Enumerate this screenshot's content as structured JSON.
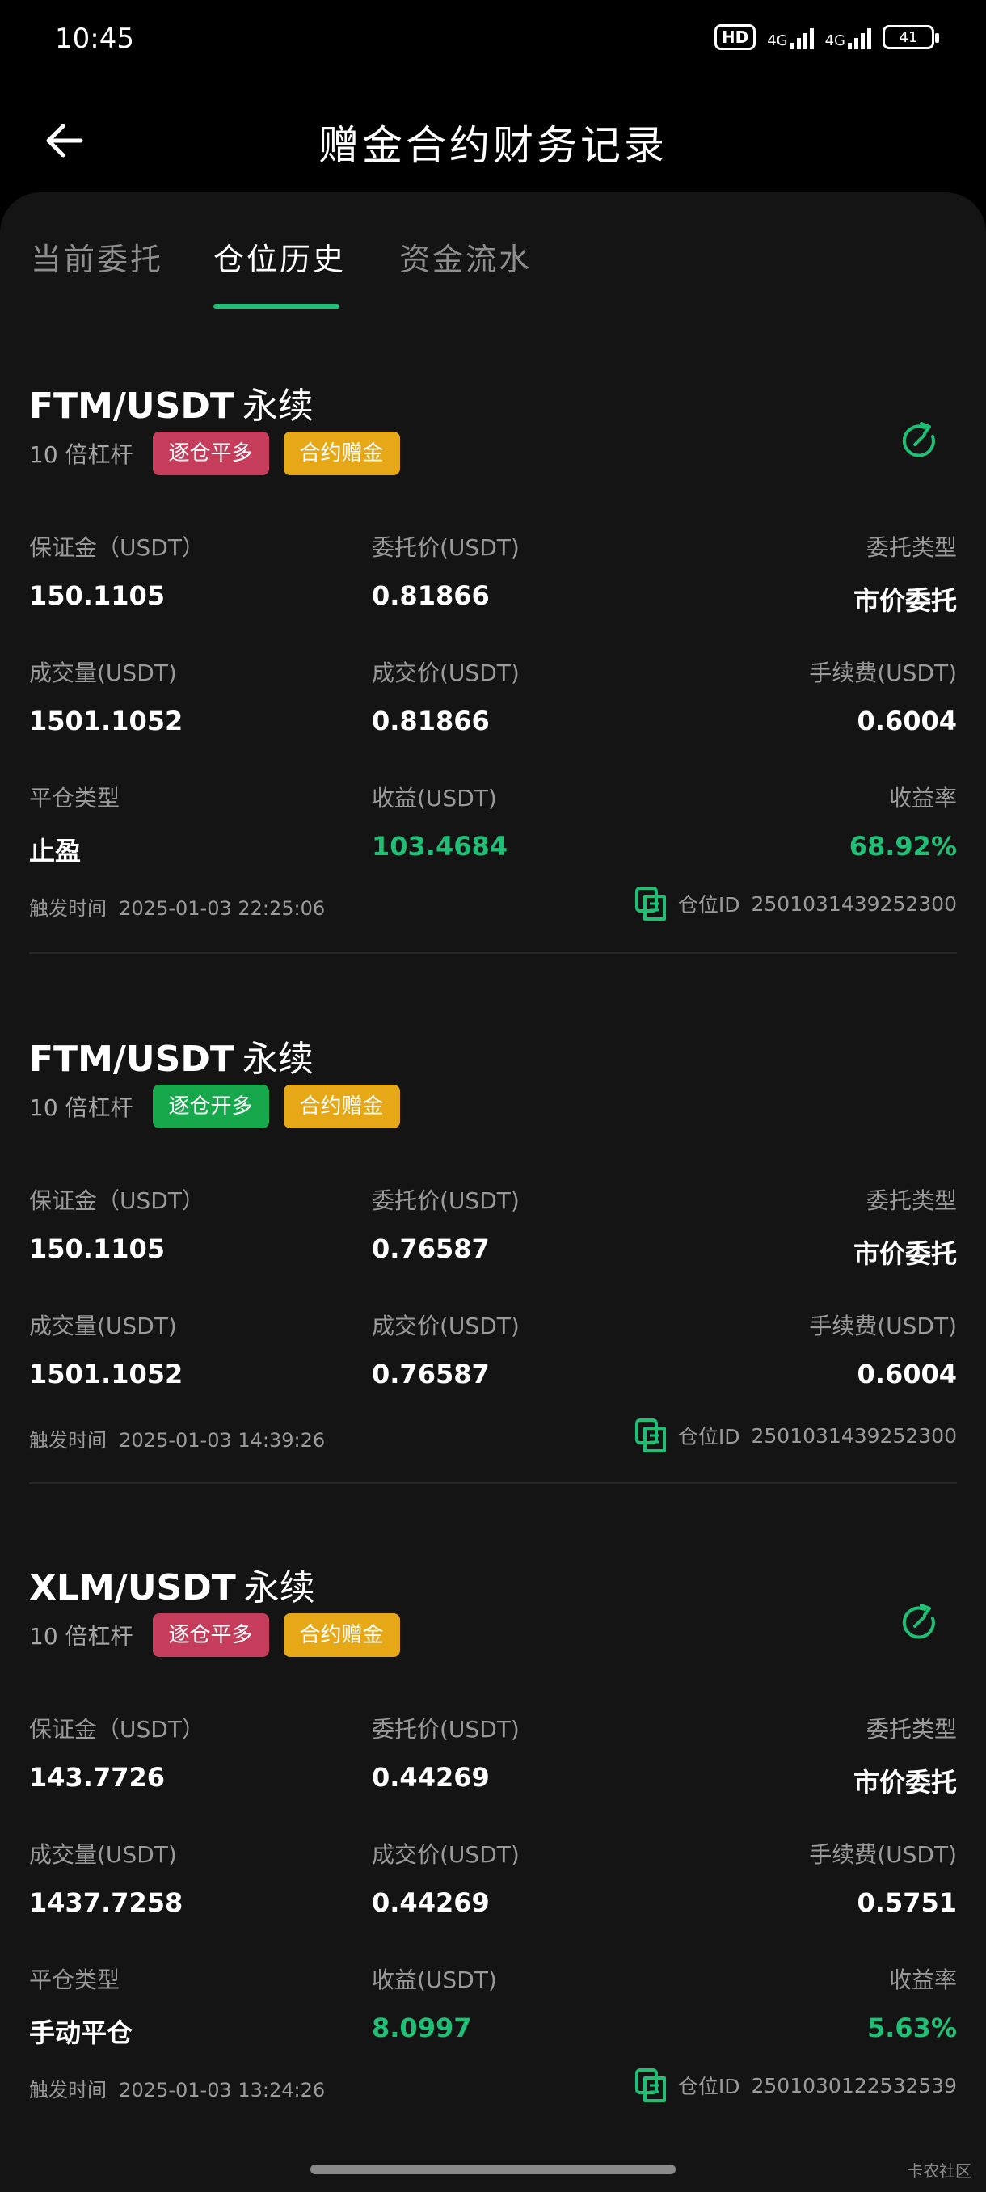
{
  "status_bar": {
    "time": "10:45",
    "hd": "HD",
    "net1": "4G",
    "net2": "4G",
    "battery": "41"
  },
  "header": {
    "title": "赠金合约财务记录"
  },
  "tabs": [
    {
      "label": "当前委托",
      "active": false
    },
    {
      "label": "仓位历史",
      "active": true
    },
    {
      "label": "资金流水",
      "active": false
    }
  ],
  "colors": {
    "accent": "#1fbf75",
    "tag_close_long": "#c63d5b",
    "tag_open_long": "#18a84c",
    "tag_bonus": "#e6a817"
  },
  "records": [
    {
      "pair": "FTM/USDT",
      "suffix": "永续",
      "leverage": "10 倍杠杆",
      "direction_tag": "逐仓平多",
      "bonus_tag": "合约赠金",
      "show_refresh": true,
      "fields": [
        {
          "label": "保证金（USDT）",
          "value": "150.1105"
        },
        {
          "label": "委托价(USDT)",
          "value": "0.81866"
        },
        {
          "label": "委托类型",
          "value": "市价委托"
        },
        {
          "label": "成交量(USDT)",
          "value": "1501.1052"
        },
        {
          "label": "成交价(USDT)",
          "value": "0.81866"
        },
        {
          "label": "手续费(USDT)",
          "value": "0.6004"
        },
        {
          "label": "平仓类型",
          "value": "止盈"
        },
        {
          "label": "收益(USDT)",
          "value": "103.4684"
        },
        {
          "label": "收益率",
          "value": "68.92%"
        }
      ],
      "trigger_label": "触发时间",
      "trigger_time": "2025-01-03  22:25:06",
      "position_id_label": "仓位ID",
      "position_id": "2501031439252300"
    },
    {
      "pair": "FTM/USDT",
      "suffix": "永续",
      "leverage": "10 倍杠杆",
      "direction_tag": "逐仓开多",
      "bonus_tag": "合约赠金",
      "show_refresh": false,
      "fields": [
        {
          "label": "保证金（USDT）",
          "value": "150.1105"
        },
        {
          "label": "委托价(USDT)",
          "value": "0.76587"
        },
        {
          "label": "委托类型",
          "value": "市价委托"
        },
        {
          "label": "成交量(USDT)",
          "value": "1501.1052"
        },
        {
          "label": "成交价(USDT)",
          "value": "0.76587"
        },
        {
          "label": "手续费(USDT)",
          "value": "0.6004"
        }
      ],
      "trigger_label": "触发时间",
      "trigger_time": "2025-01-03  14:39:26",
      "position_id_label": "仓位ID",
      "position_id": "2501031439252300"
    },
    {
      "pair": "XLM/USDT",
      "suffix": "永续",
      "leverage": "10 倍杠杆",
      "direction_tag": "逐仓平多",
      "bonus_tag": "合约赠金",
      "show_refresh": true,
      "fields": [
        {
          "label": "保证金（USDT）",
          "value": "143.7726"
        },
        {
          "label": "委托价(USDT)",
          "value": "0.44269"
        },
        {
          "label": "委托类型",
          "value": "市价委托"
        },
        {
          "label": "成交量(USDT)",
          "value": "1437.7258"
        },
        {
          "label": "成交价(USDT)",
          "value": "0.44269"
        },
        {
          "label": "手续费(USDT)",
          "value": "0.5751"
        },
        {
          "label": "平仓类型",
          "value": "手动平仓"
        },
        {
          "label": "收益(USDT)",
          "value": "8.0997"
        },
        {
          "label": "收益率",
          "value": "5.63%"
        }
      ],
      "trigger_label": "触发时间",
      "trigger_time": "2025-01-03  13:24:26",
      "position_id_label": "仓位ID",
      "position_id": "2501030122532539"
    }
  ],
  "watermark": "卡农社区"
}
